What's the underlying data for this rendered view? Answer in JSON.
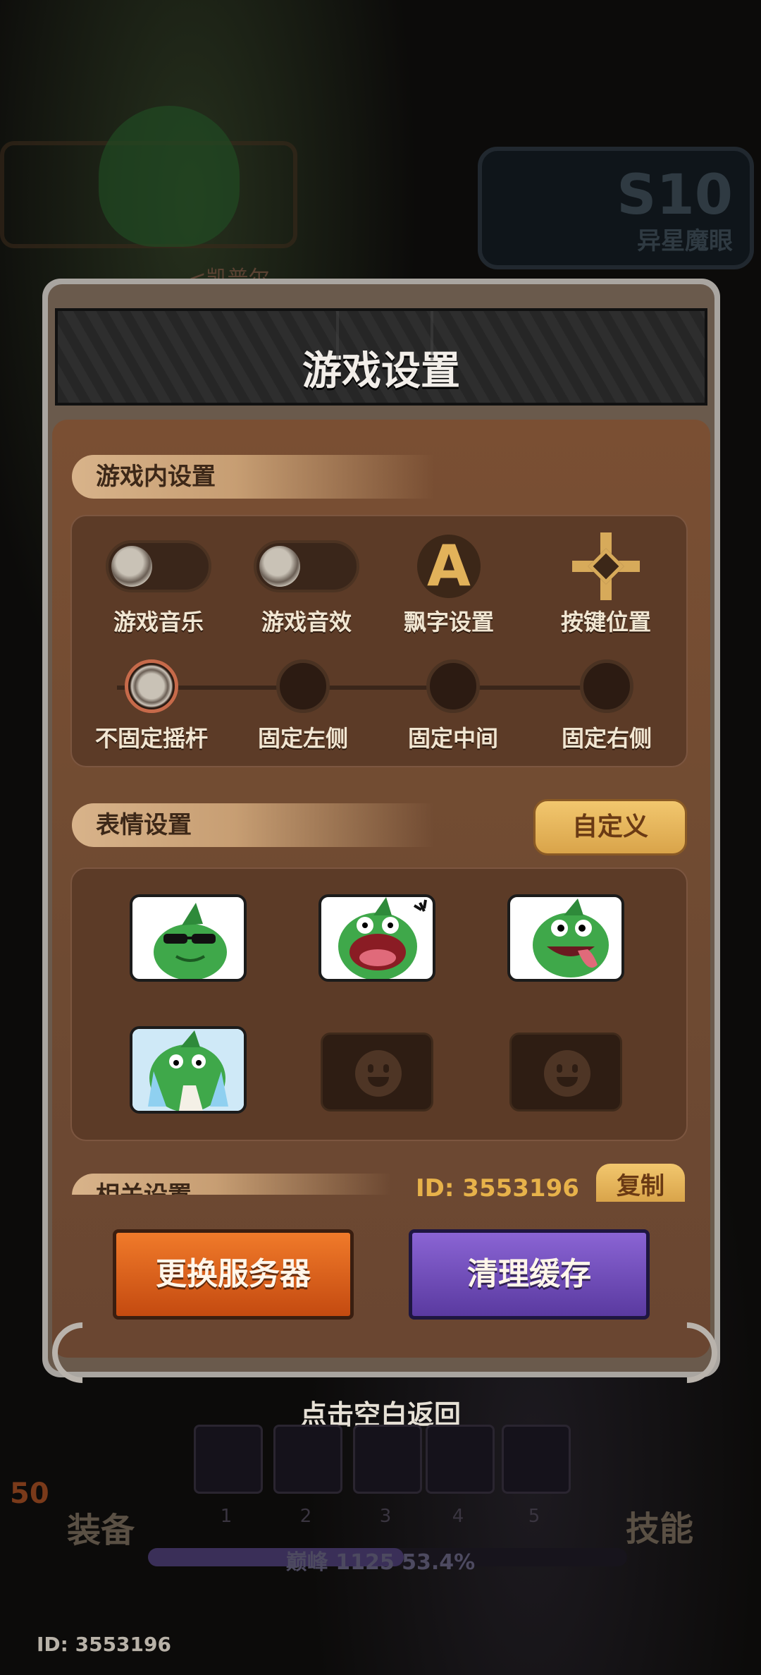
{
  "background": {
    "character_name": "<凯普尔>",
    "season_number": "S10",
    "season_name": "异星魔眼",
    "hint_text": "点击空白返回",
    "equip_label": "装备",
    "skill_label": "技能",
    "level": "50",
    "slot_numbers": [
      "1",
      "2",
      "3",
      "4",
      "5"
    ],
    "exp_text": "巅峰 1125  53.4%",
    "exp_fraction": 0.534,
    "bottom_id": "ID: 3553196"
  },
  "dialog": {
    "title": "游戏设置",
    "ingame_section": {
      "title": "游戏内设置",
      "options": [
        {
          "label": "游戏音乐",
          "type": "toggle",
          "on": false
        },
        {
          "label": "游戏音效",
          "type": "toggle",
          "on": false
        },
        {
          "label": "飘字设置",
          "type": "icon",
          "icon": "letter-a-icon",
          "glyph": "A"
        },
        {
          "label": "按键位置",
          "type": "icon",
          "icon": "move-arrows-icon"
        }
      ],
      "joystick_options": [
        {
          "label": "不固定摇杆",
          "selected": true
        },
        {
          "label": "固定左侧",
          "selected": false
        },
        {
          "label": "固定中间",
          "selected": false
        },
        {
          "label": "固定右侧",
          "selected": false
        }
      ]
    },
    "emote_section": {
      "title": "表情设置",
      "custom_button": "自定义",
      "emotes": [
        {
          "name": "frog-cool-sunglasses",
          "filled": true
        },
        {
          "name": "frog-shouting",
          "filled": true
        },
        {
          "name": "frog-tongue-out",
          "filled": true
        },
        {
          "name": "frog-crying",
          "filled": true
        },
        {
          "name": "empty-slot",
          "filled": false
        },
        {
          "name": "empty-slot",
          "filled": false
        }
      ]
    },
    "related_section": {
      "title": "相关设置",
      "id_text": "ID: 3553196",
      "copy_button": "复制"
    },
    "buttons": {
      "change_server": "更换服务器",
      "clear_cache": "清理缓存"
    }
  },
  "colors": {
    "panel": "#6e4a32",
    "gold_button": "#e2b25a",
    "orange_button": "#e0631e",
    "purple_button": "#6f4cb8"
  }
}
